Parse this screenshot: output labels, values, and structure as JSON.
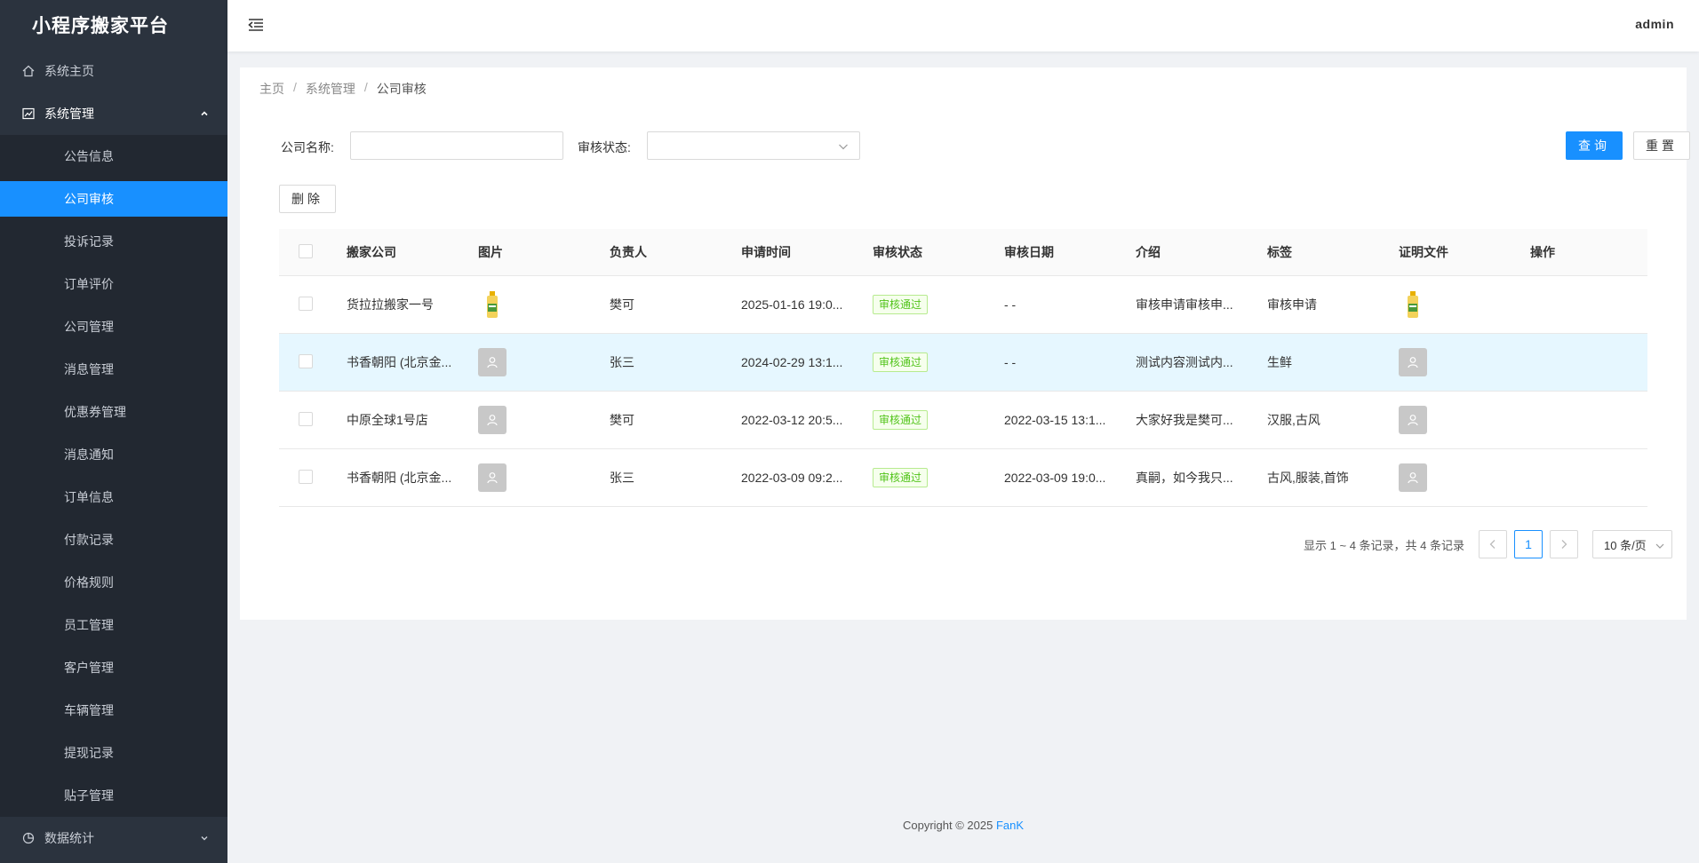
{
  "app": {
    "title": "小程序搬家平台",
    "user": "admin"
  },
  "sidebar": {
    "home": {
      "label": "系统主页",
      "icon": "home-icon"
    },
    "system": {
      "label": "系统管理",
      "icon": "chart-line-icon",
      "items": [
        {
          "label": "公告信息"
        },
        {
          "label": "公司审核",
          "active": true
        },
        {
          "label": "投诉记录"
        },
        {
          "label": "订单评价"
        },
        {
          "label": "公司管理"
        },
        {
          "label": "消息管理"
        },
        {
          "label": "优惠券管理"
        },
        {
          "label": "消息通知"
        },
        {
          "label": "订单信息"
        },
        {
          "label": "付款记录"
        },
        {
          "label": "价格规则"
        },
        {
          "label": "员工管理"
        },
        {
          "label": "客户管理"
        },
        {
          "label": "车辆管理"
        },
        {
          "label": "提现记录"
        },
        {
          "label": "贴子管理"
        }
      ]
    },
    "stats": {
      "label": "数据统计",
      "icon": "pie-chart-icon"
    }
  },
  "breadcrumb": [
    "主页",
    "系统管理",
    "公司审核"
  ],
  "search": {
    "company_label": "公司名称:",
    "company_value": "",
    "status_label": "审核状态:",
    "status_value": "",
    "query_button": "查询",
    "reset_button": "重置"
  },
  "toolbar": {
    "delete_button": "删除"
  },
  "table": {
    "headers": [
      "搬家公司",
      "图片",
      "负责人",
      "申请时间",
      "审核状态",
      "审核日期",
      "介绍",
      "标签",
      "证明文件",
      "操作"
    ],
    "rows": [
      {
        "company": "货拉拉搬家一号",
        "image": "bottle",
        "manager": "樊可",
        "apply_time": "2025-01-16 19:0...",
        "status": "审核通过",
        "review_date": "- -",
        "intro": "审核申请审核申...",
        "tags": "审核申请",
        "doc": "bottle"
      },
      {
        "company": "书香朝阳 (北京金...",
        "image": "avatar",
        "manager": "张三",
        "apply_time": "2024-02-29 13:1...",
        "status": "审核通过",
        "review_date": "- -",
        "intro": "测试内容测试内...",
        "tags": "生鲜",
        "doc": "avatar"
      },
      {
        "company": "中原全球1号店",
        "image": "avatar",
        "manager": "樊可",
        "apply_time": "2022-03-12 20:5...",
        "status": "审核通过",
        "review_date": "2022-03-15 13:1...",
        "intro": "大家好我是樊可...",
        "tags": "汉服,古风",
        "doc": "avatar"
      },
      {
        "company": "书香朝阳 (北京金...",
        "image": "avatar",
        "manager": "张三",
        "apply_time": "2022-03-09 09:2...",
        "status": "审核通过",
        "review_date": "2022-03-09 19:0...",
        "intro": "真嗣，如今我只...",
        "tags": "古风,服装,首饰",
        "doc": "avatar"
      }
    ]
  },
  "pagination": {
    "summary": "显示 1 ~ 4 条记录，共 4 条记录",
    "current_page": "1",
    "page_size": "10 条/页"
  },
  "footer": {
    "copyright": "Copyright © 2025",
    "brand": "FanK"
  },
  "colors": {
    "accent": "#1890ff",
    "sidebar": "#2b333e",
    "success": "#52c41a"
  }
}
